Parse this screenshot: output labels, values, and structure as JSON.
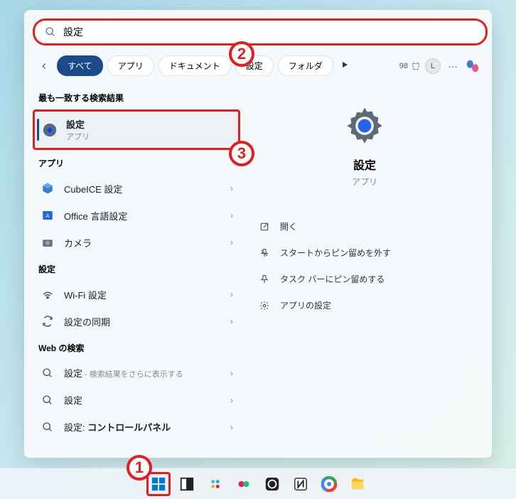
{
  "search": {
    "value": "設定"
  },
  "filters": {
    "all": "すべて",
    "apps": "アプリ",
    "documents": "ドキュメント",
    "settings": "設定",
    "folder": "フォルダ"
  },
  "reward_points": "98",
  "avatar_letter": "L",
  "sections": {
    "best_match": "最も一致する検索結果",
    "apps": "アプリ",
    "settings": "設定",
    "web": "Web の検索"
  },
  "best_match": {
    "title": "設定",
    "sub": "アプリ"
  },
  "app_results": [
    {
      "title": "CubeICE 設定"
    },
    {
      "title": "Office 言語設定"
    },
    {
      "title": "カメラ"
    }
  ],
  "settings_results": [
    {
      "title": "Wi-Fi 設定"
    },
    {
      "title": "設定の同期"
    }
  ],
  "web_results": [
    {
      "title": "設定",
      "hint": " - 検索結果をさらに表示する"
    },
    {
      "title": "設定"
    },
    {
      "title": "設定: ",
      "bold": "コントロールパネル"
    }
  ],
  "preview": {
    "title": "設定",
    "sub": "アプリ"
  },
  "actions": {
    "open": "開く",
    "unpin_start": "スタートからピン留めを外す",
    "pin_taskbar": "タスク バーにピン留めする",
    "app_settings": "アプリの設定"
  },
  "annotations": {
    "a1": "1",
    "a2": "2",
    "a3": "3"
  }
}
